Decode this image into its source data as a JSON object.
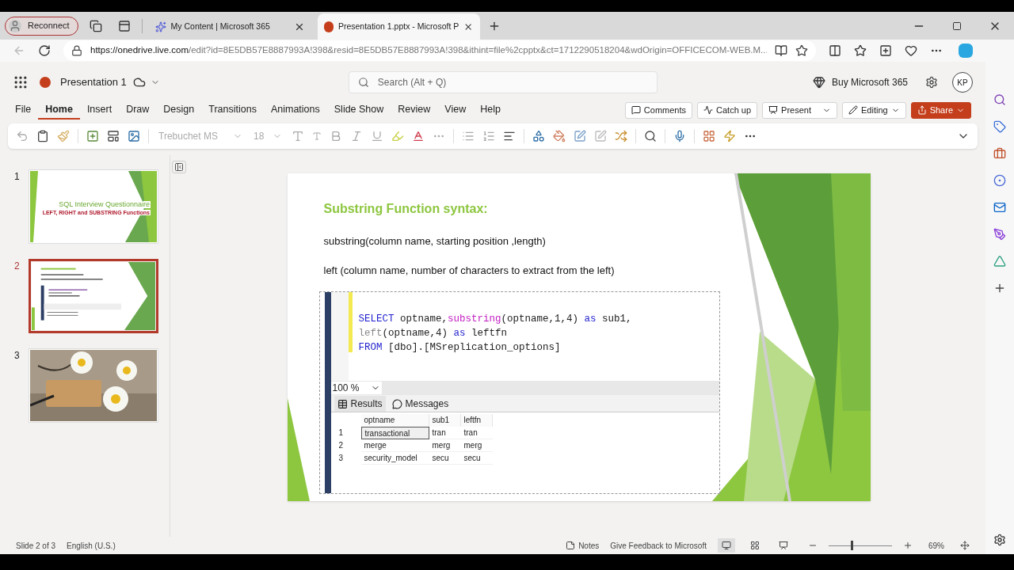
{
  "browser": {
    "reconnect": "Reconnect",
    "tabs": [
      {
        "title": "My Content | Microsoft 365",
        "selected": false,
        "kind": "m365"
      },
      {
        "title": "Presentation 1.pptx - Microsoft P",
        "selected": true,
        "kind": "ppt"
      }
    ],
    "url_host": "https://onedrive.live.com",
    "url_rest": "/edit?id=8E5DB57E8887993A!398&resid=8E5DB57E8887993A!398&ithint=file%2cpptx&ct=1712290518204&wdOrigin=OFFICECOM-WEB.M..."
  },
  "app": {
    "doc_title": "Presentation 1",
    "search_placeholder": "Search (Alt + Q)",
    "buy": "Buy Microsoft 365",
    "avatar": "KP"
  },
  "ribbon_tabs": [
    {
      "label": "File",
      "selected": false
    },
    {
      "label": "Home",
      "selected": true
    },
    {
      "label": "Insert",
      "selected": false
    },
    {
      "label": "Draw",
      "selected": false
    },
    {
      "label": "Design",
      "selected": false
    },
    {
      "label": "Transitions",
      "selected": false
    },
    {
      "label": "Animations",
      "selected": false
    },
    {
      "label": "Slide Show",
      "selected": false
    },
    {
      "label": "Review",
      "selected": false
    },
    {
      "label": "View",
      "selected": false
    },
    {
      "label": "Help",
      "selected": false
    }
  ],
  "actions": [
    {
      "label": "Comments",
      "kind": "comments"
    },
    {
      "label": "Catch up",
      "kind": "catchup"
    },
    {
      "label": "Present",
      "kind": "present"
    },
    {
      "label": "Editing",
      "kind": "editing"
    },
    {
      "label": "Share",
      "kind": "share"
    }
  ],
  "toolbar": {
    "font": "Trebuchet MS",
    "size": "18"
  },
  "thumbnails": [
    {
      "number": "1",
      "selected": false,
      "kind": "title",
      "title": "SQL Interview Questionnaire",
      "subtitle": "LEFT, RIGHT and SUBSTRING Functions"
    },
    {
      "number": "2",
      "selected": true,
      "kind": "content"
    },
    {
      "number": "3",
      "selected": false,
      "kind": "picture"
    }
  ],
  "slide": {
    "title": "Substring Function syntax:",
    "lines": [
      "substring(column name, starting position ,length)",
      "left (column name, number of characters to extract from the left)"
    ],
    "code": [
      [
        {
          "text": "SELECT",
          "kind": "keyword"
        },
        {
          "text": " optname,",
          "kind": "plain"
        },
        {
          "text": "substring",
          "kind": "function"
        },
        {
          "text": "(optname,1,4) ",
          "kind": "plain"
        },
        {
          "text": "as",
          "kind": "keyword"
        },
        {
          "text": " sub1,",
          "kind": "plain"
        }
      ],
      [
        {
          "text": "left",
          "kind": "gray"
        },
        {
          "text": "(optname,4) ",
          "kind": "plain"
        },
        {
          "text": "as",
          "kind": "keyword"
        },
        {
          "text": " leftfn",
          "kind": "plain"
        }
      ],
      [
        {
          "text": "FROM",
          "kind": "keyword"
        },
        {
          "text": " [dbo].[MSreplication_options]",
          "kind": "plain"
        }
      ]
    ],
    "zoom": "100 %",
    "result_tabs": [
      {
        "label": "Results",
        "selected": true,
        "kind": "grid"
      },
      {
        "label": "Messages",
        "selected": false,
        "kind": "messages"
      }
    ],
    "columns": [
      "optname",
      "sub1",
      "leftfn"
    ],
    "rows": [
      {
        "number": "1",
        "cells": [
          "transactional",
          "tran",
          "tran"
        ],
        "selected": true
      },
      {
        "number": "2",
        "cells": [
          "merge",
          "merg",
          "merg"
        ],
        "selected": false
      },
      {
        "number": "3",
        "cells": [
          "security_model",
          "secu",
          "secu"
        ],
        "selected": false
      }
    ]
  },
  "status": {
    "slide": "Slide 2 of 3",
    "language": "English (U.S.)",
    "notes": "Notes",
    "feedback": "Give Feedback to Microsoft",
    "views": [
      {
        "kind": "normal",
        "selected": true
      },
      {
        "kind": "sorter",
        "selected": false
      },
      {
        "kind": "reading",
        "selected": false
      }
    ],
    "zoom_slider": {
      "level": 0.35
    },
    "zoom": "69%"
  }
}
